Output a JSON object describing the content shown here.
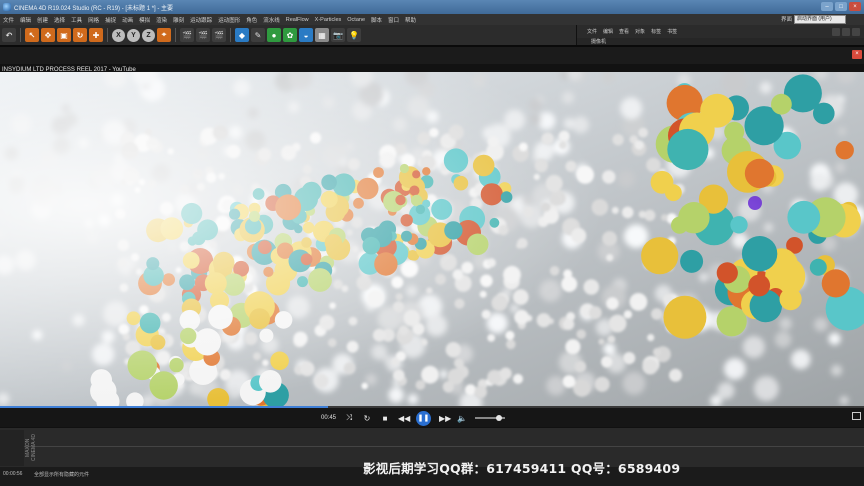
{
  "titlebar": {
    "title": "CINEMA 4D R19.024 Studio (RC - R19) - [未标题 1 *] - 主要"
  },
  "menu": {
    "items": [
      "文件",
      "编辑",
      "创建",
      "选择",
      "工具",
      "网格",
      "捕捉",
      "动画",
      "模拟",
      "渲染",
      "雕刻",
      "运动跟踪",
      "运动图形",
      "角色",
      "流水线",
      "RealFlow",
      "X-Particles",
      "Octane",
      "脚本",
      "窗口",
      "帮助"
    ],
    "layout_label": "界面",
    "layout_value": "启动界面 (用户)"
  },
  "toolbar": {
    "undo_icon": "undo-icon",
    "axis_x": "X",
    "axis_y": "Y",
    "axis_z": "Z"
  },
  "right_panel": {
    "tabs": [
      "文件",
      "编辑",
      "查看",
      "对象",
      "标签",
      "书签"
    ],
    "row2_label": "摄像机"
  },
  "browser": {
    "video_title": "INSYDIUM LTD PROCESS REEL 2017 - YouTube",
    "close_label": "×"
  },
  "player": {
    "current_time": "00:45",
    "progress_fraction": 0.38,
    "volume_fraction": 0.8
  },
  "timeline": {
    "brand": "MAXON CINEMA 4D"
  },
  "statusbar": {
    "time": "00:00:56",
    "message": "全部显示所有隐藏的元件"
  },
  "watermark": {
    "text": "影视后期学习QQ群：617459411  QQ号：6589409"
  }
}
